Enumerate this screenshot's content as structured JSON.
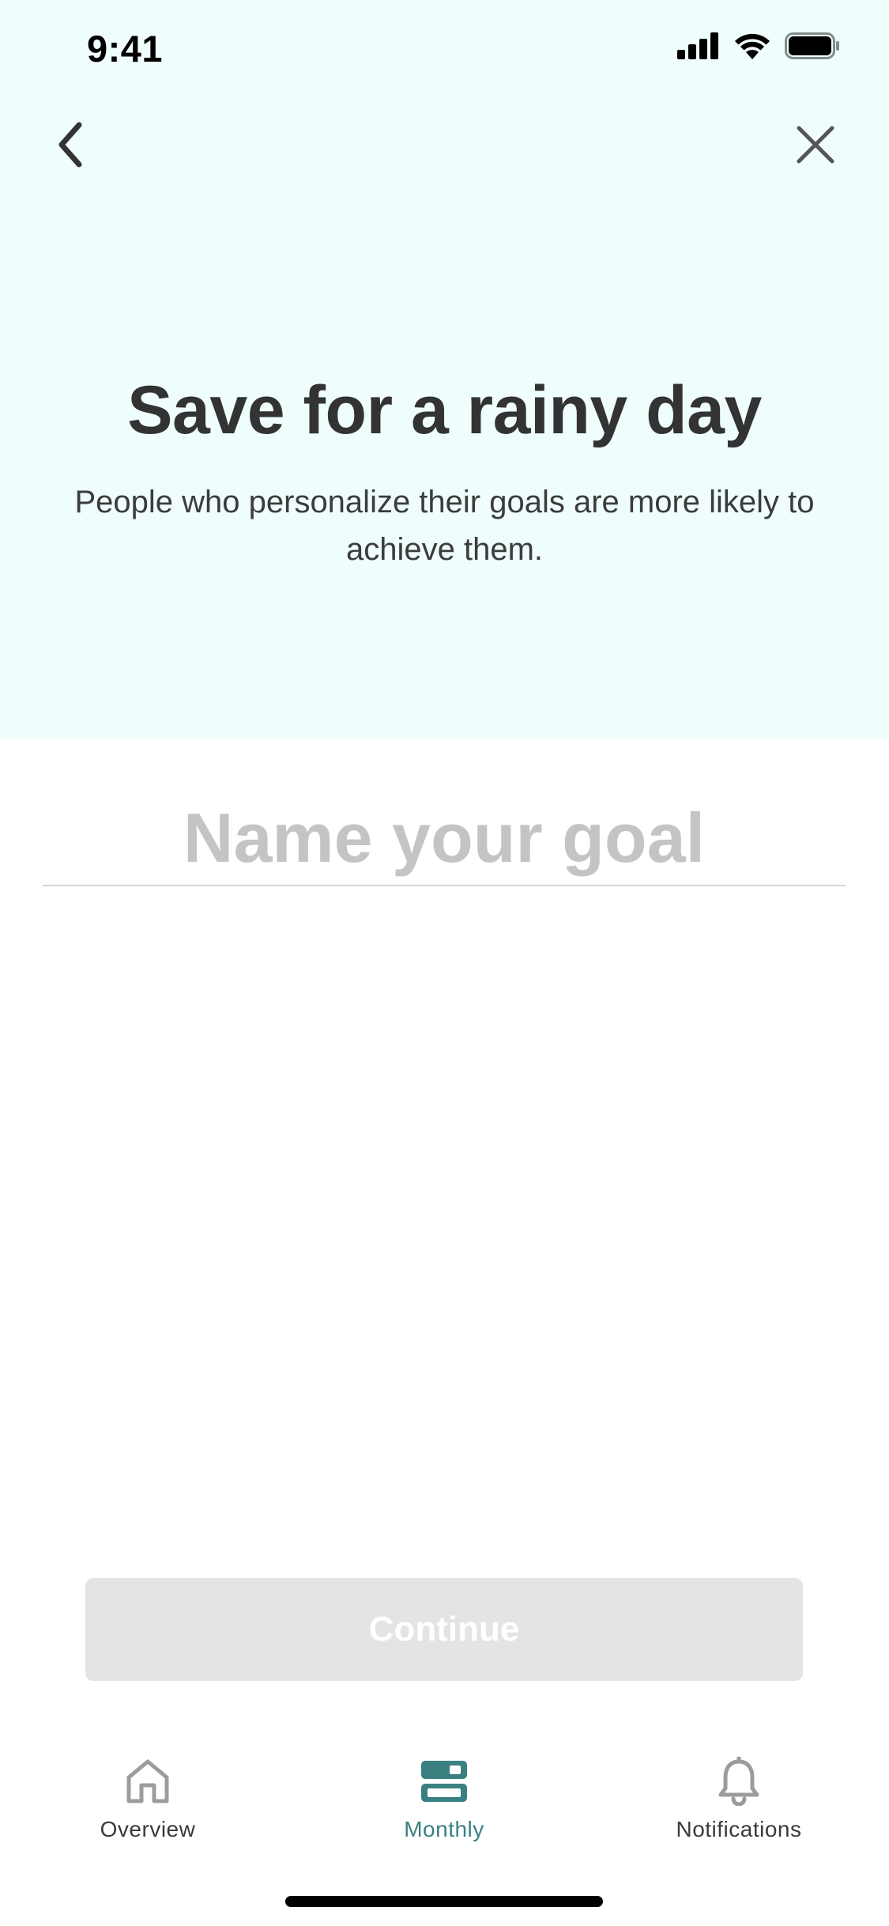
{
  "status_bar": {
    "time": "9:41"
  },
  "nav": {
    "back_icon": "chevron-left-icon",
    "close_icon": "close-icon"
  },
  "hero": {
    "title": "Save for a rainy day",
    "subtitle": "People who personalize their goals are more likely to achieve them."
  },
  "goal": {
    "placeholder": "Name your goal",
    "value": ""
  },
  "continue_label": "Continue",
  "tabs": [
    {
      "label": "Overview",
      "icon": "home-icon",
      "active": false
    },
    {
      "label": "Monthly",
      "icon": "monthly-icon",
      "active": true
    },
    {
      "label": "Notifications",
      "icon": "bell-icon",
      "active": false
    }
  ],
  "colors": {
    "hero_background": "#effdfd",
    "accent": "#3b8080",
    "title_text": "#333333",
    "disabled_button": "#e4e4e4",
    "placeholder": "#c4c4c4"
  }
}
